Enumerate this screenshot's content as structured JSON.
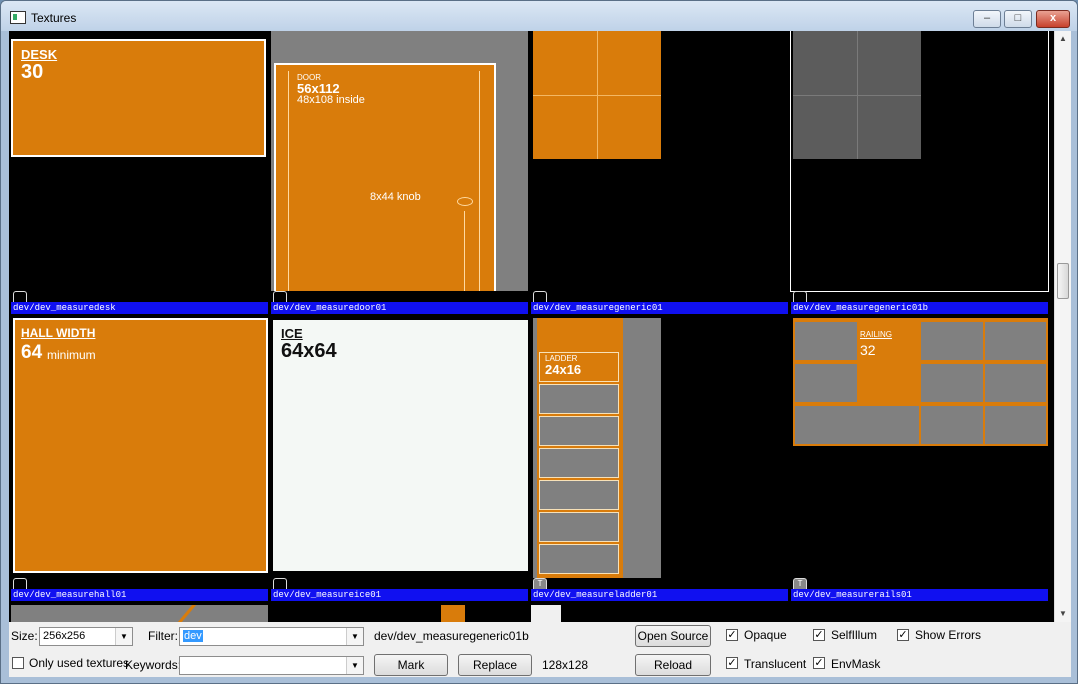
{
  "window": {
    "title": "Textures"
  },
  "titlebar_buttons": {
    "minimize": "–",
    "maximize": "□",
    "close": "x"
  },
  "textures": [
    {
      "name": "dev/dev_measuredesk",
      "title": "DESK",
      "value": "30"
    },
    {
      "name": "dev/dev_measuredoor01",
      "title": "DOOR",
      "line1": "56x112",
      "line2": "48x108 inside",
      "knob": "8x44 knob"
    },
    {
      "name": "dev/dev_measuregeneric01"
    },
    {
      "name": "dev/dev_measuregeneric01b"
    },
    {
      "name": "dev/dev_measurehall01",
      "title": "HALL WIDTH",
      "value": "64",
      "suffix": "minimum"
    },
    {
      "name": "dev/dev_measureice01",
      "title": "ICE",
      "value": "64x64"
    },
    {
      "name": "dev/dev_measureladder01",
      "title": "LADDER",
      "value": "24x16",
      "badge": "T"
    },
    {
      "name": "dev/dev_measurerails01",
      "title": "RAILING",
      "value": "32",
      "badge": "T"
    }
  ],
  "controls": {
    "size_label": "Size:",
    "size_value": "256x256",
    "filter_label": "Filter:",
    "filter_value": "dev",
    "current_texture": "dev/dev_measuregeneric01b",
    "dimensions": "128x128",
    "open_source": "Open Source",
    "reload": "Reload",
    "mark": "Mark",
    "replace": "Replace",
    "only_used": "Only used textures",
    "keywords_label": "Keywords:",
    "keywords_value": "",
    "opaque": "Opaque",
    "translucent": "Translucent",
    "selfillum": "SelfIllum",
    "envmask": "EnvMask",
    "show_errors": "Show Errors"
  },
  "checkbox_state": {
    "only_used": false,
    "opaque": true,
    "translucent": true,
    "selfillum": true,
    "envmask": true,
    "show_errors": true
  },
  "icons": {
    "dropdown": "▼",
    "scroll_up": "▲",
    "scroll_down": "▼",
    "check": "✓"
  }
}
